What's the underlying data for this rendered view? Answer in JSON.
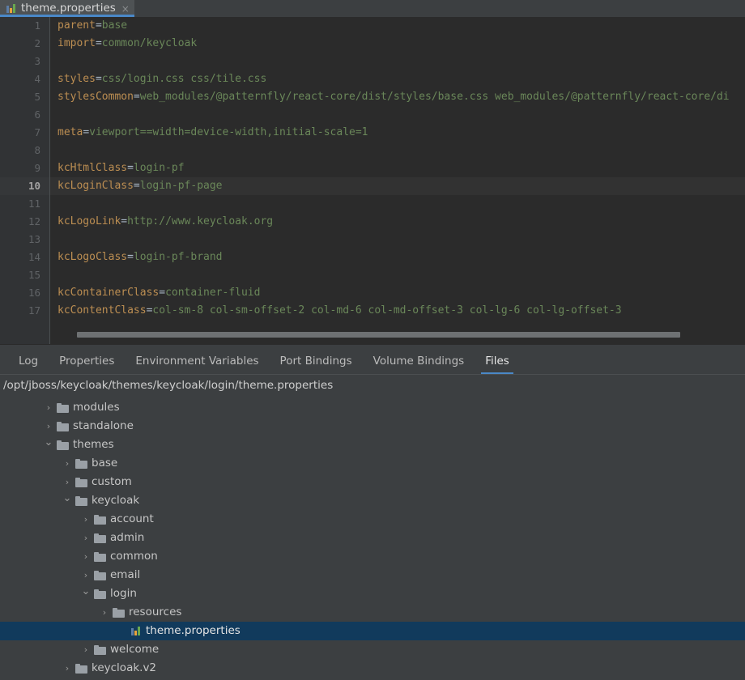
{
  "editor": {
    "tab": {
      "title": "theme.properties",
      "icon": "properties-file-icon",
      "close_icon": "close-icon"
    },
    "lines": [
      {
        "n": "1",
        "key": "parent",
        "value": "base"
      },
      {
        "n": "2",
        "key": "import",
        "value": "common/keycloak"
      },
      {
        "n": "3",
        "key": "",
        "value": ""
      },
      {
        "n": "4",
        "key": "styles",
        "value": "css/login.css css/tile.css"
      },
      {
        "n": "5",
        "key": "stylesCommon",
        "value": "web_modules/@patternfly/react-core/dist/styles/base.css web_modules/@patternfly/react-core/di"
      },
      {
        "n": "6",
        "key": "",
        "value": ""
      },
      {
        "n": "7",
        "key": "meta",
        "value": "viewport==width=device-width,initial-scale=1"
      },
      {
        "n": "8",
        "key": "",
        "value": ""
      },
      {
        "n": "9",
        "key": "kcHtmlClass",
        "value": "login-pf"
      },
      {
        "n": "10",
        "key": "kcLoginClass",
        "value": "login-pf-page"
      },
      {
        "n": "11",
        "key": "",
        "value": ""
      },
      {
        "n": "12",
        "key": "kcLogoLink",
        "value": "http://www.keycloak.org"
      },
      {
        "n": "13",
        "key": "",
        "value": ""
      },
      {
        "n": "14",
        "key": "kcLogoClass",
        "value": "login-pf-brand"
      },
      {
        "n": "15",
        "key": "",
        "value": ""
      },
      {
        "n": "16",
        "key": "kcContainerClass",
        "value": "container-fluid"
      },
      {
        "n": "17",
        "key": "kcContentClass",
        "value": "col-sm-8 col-sm-offset-2 col-md-6 col-md-offset-3 col-lg-6 col-lg-offset-3"
      }
    ],
    "current_line": "10",
    "colors": {
      "background": "#2b2b2b",
      "current_line": "#323232",
      "gutter": "#313335",
      "key": "#bc8e52",
      "value": "#6a8759",
      "separator": "#a9b7c6"
    }
  },
  "panel": {
    "tabs": [
      {
        "label": "Log",
        "active": false
      },
      {
        "label": "Properties",
        "active": false
      },
      {
        "label": "Environment Variables",
        "active": false
      },
      {
        "label": "Port Bindings",
        "active": false
      },
      {
        "label": "Volume Bindings",
        "active": false
      },
      {
        "label": "Files",
        "active": true
      }
    ],
    "path": "/opt/jboss/keycloak/themes/keycloak/login/theme.properties",
    "accent": "#4a88c7",
    "selection_color": "#113a5c",
    "tree": [
      {
        "label": "modules",
        "indent": 1,
        "type": "folder",
        "state": "collapsed",
        "selected": false
      },
      {
        "label": "standalone",
        "indent": 1,
        "type": "folder",
        "state": "collapsed",
        "selected": false
      },
      {
        "label": "themes",
        "indent": 1,
        "type": "folder",
        "state": "expanded",
        "selected": false
      },
      {
        "label": "base",
        "indent": 2,
        "type": "folder",
        "state": "collapsed",
        "selected": false
      },
      {
        "label": "custom",
        "indent": 2,
        "type": "folder",
        "state": "collapsed",
        "selected": false
      },
      {
        "label": "keycloak",
        "indent": 2,
        "type": "folder",
        "state": "expanded",
        "selected": false
      },
      {
        "label": "account",
        "indent": 3,
        "type": "folder",
        "state": "collapsed",
        "selected": false
      },
      {
        "label": "admin",
        "indent": 3,
        "type": "folder",
        "state": "collapsed",
        "selected": false
      },
      {
        "label": "common",
        "indent": 3,
        "type": "folder",
        "state": "collapsed",
        "selected": false
      },
      {
        "label": "email",
        "indent": 3,
        "type": "folder",
        "state": "collapsed",
        "selected": false
      },
      {
        "label": "login",
        "indent": 3,
        "type": "folder",
        "state": "expanded",
        "selected": false
      },
      {
        "label": "resources",
        "indent": 4,
        "type": "folder",
        "state": "collapsed",
        "selected": false
      },
      {
        "label": "theme.properties",
        "indent": 5,
        "type": "file",
        "state": "none",
        "selected": true
      },
      {
        "label": "welcome",
        "indent": 3,
        "type": "folder",
        "state": "collapsed",
        "selected": false
      },
      {
        "label": "keycloak.v2",
        "indent": 2,
        "type": "folder",
        "state": "collapsed",
        "selected": false
      }
    ]
  },
  "icons": {
    "chevron_right": "›",
    "chevron_down": "⌄",
    "close": "×"
  }
}
